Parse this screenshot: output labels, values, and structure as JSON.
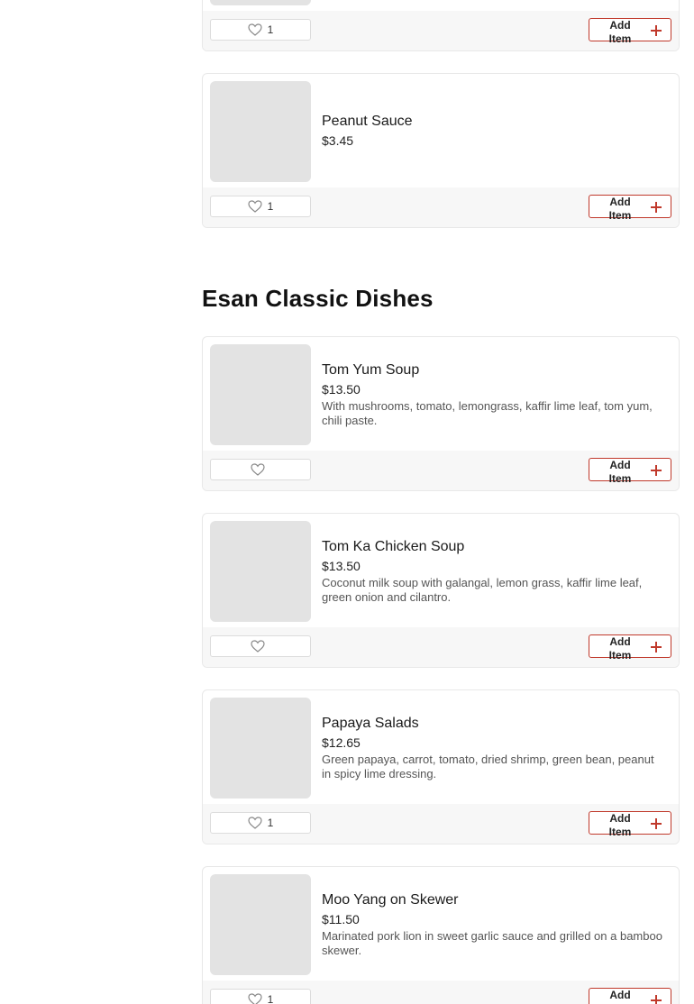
{
  "colors": {
    "accent": "#c0392b",
    "thumb": "#e3e3e3",
    "footer": "#f7f7f7"
  },
  "icons": {
    "like": "heart-outline-icon",
    "add": "plus-icon"
  },
  "add_label": "Add Item",
  "section": {
    "title": "Esan Classic Dishes"
  },
  "items": [
    {
      "name": "",
      "price": "",
      "desc": "",
      "likes": "1"
    },
    {
      "name": "Peanut Sauce",
      "price": "$3.45",
      "desc": "",
      "likes": "1"
    },
    {
      "name": "Tom Yum Soup",
      "price": "$13.50",
      "desc": "With mushrooms, tomato, lemongrass, kaffir lime leaf, tom yum, chili paste.",
      "likes": ""
    },
    {
      "name": "Tom Ka Chicken Soup",
      "price": "$13.50",
      "desc": "Coconut milk soup with galangal, lemon grass, kaffir lime leaf, green onion and cilantro.",
      "likes": ""
    },
    {
      "name": "Papaya Salads",
      "price": "$12.65",
      "desc": "Green papaya, carrot, tomato, dried shrimp, green bean, peanut in spicy lime dressing.",
      "likes": "1"
    },
    {
      "name": "Moo Yang on Skewer",
      "price": "$11.50",
      "desc": "Marinated pork lion in sweet garlic sauce and grilled on a bamboo skewer.",
      "likes": "1"
    }
  ]
}
